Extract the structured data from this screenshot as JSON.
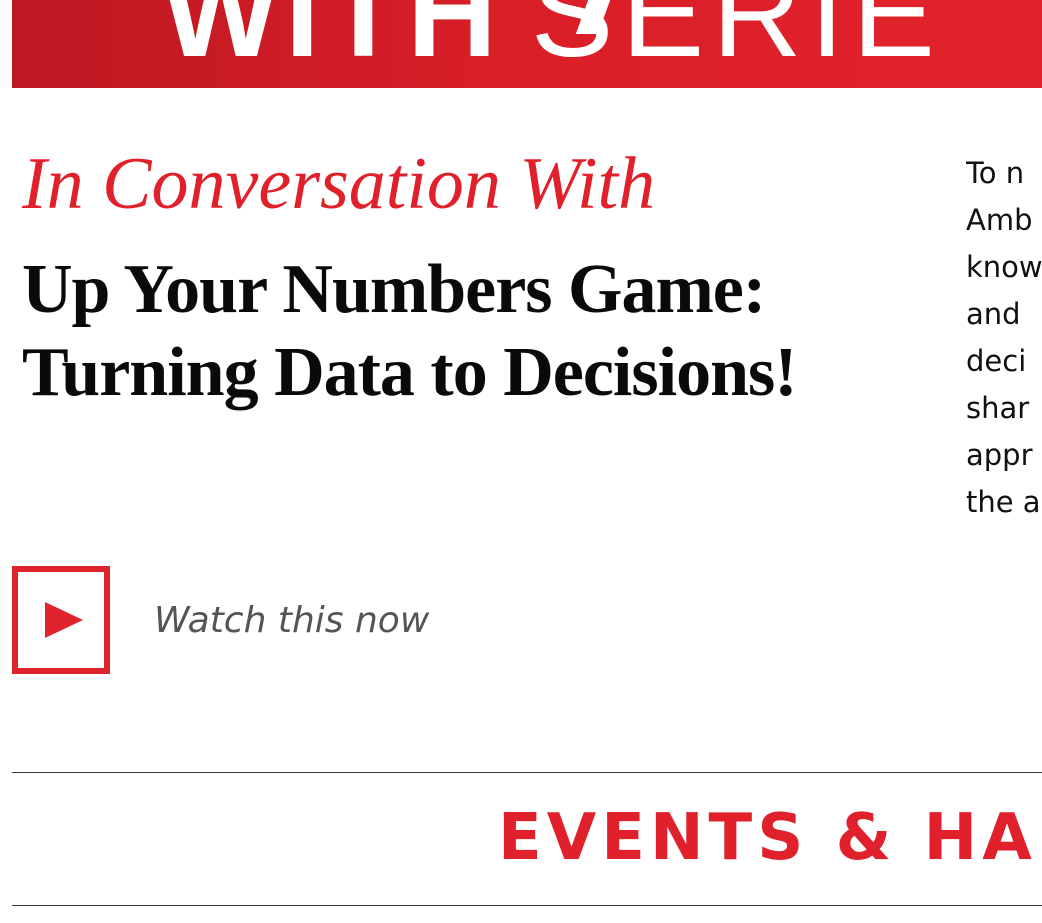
{
  "banner": {
    "text_bold": "WITH",
    "text_light": "SERIE",
    "color": "#d81e27"
  },
  "feature": {
    "series_title": "In Conversation With",
    "episode_title": "Up Your Numbers Game: Turning Data to Decisions!",
    "description_lines": [
      "To n",
      "Amb",
      "know",
      "and",
      "deci",
      "shar",
      "appr",
      "the a"
    ],
    "watch": {
      "label": "Watch this now",
      "icon": "play-icon"
    }
  },
  "section": {
    "heading": "EVENTS & HA"
  },
  "colors": {
    "accent_red": "#e0202a",
    "text_dark": "#0a0a0a",
    "text_muted": "#555555"
  }
}
